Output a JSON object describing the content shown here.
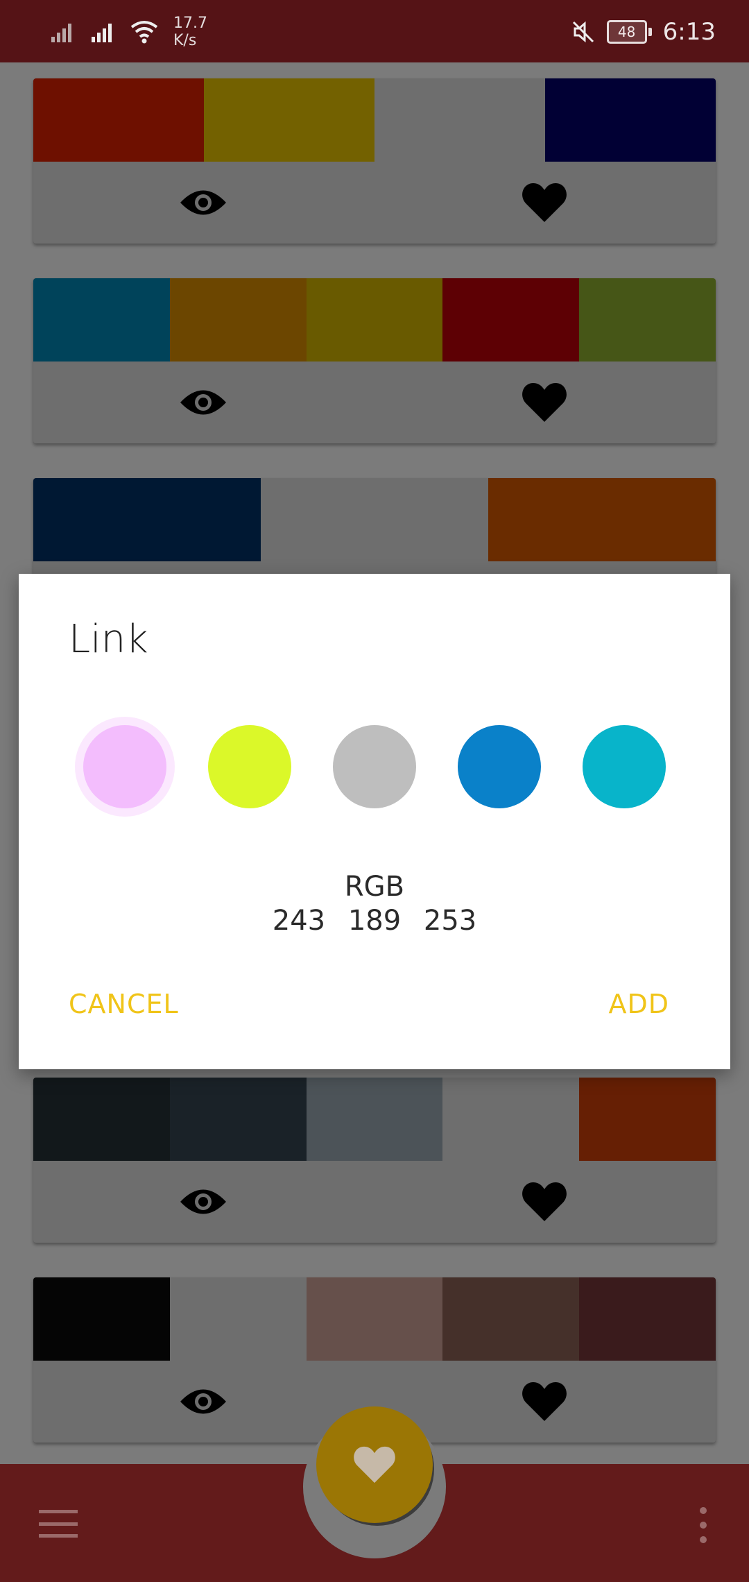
{
  "status_bar": {
    "net_speed_value": "17.7",
    "net_speed_unit": "K/s",
    "battery": "48",
    "time": "6:13"
  },
  "palettes": [
    {
      "colors": [
        "#6e1000",
        "#736100",
        "#6e6e6e",
        "#010034"
      ]
    },
    {
      "colors": [
        "#00435a",
        "#6c4600",
        "#695a00",
        "#5d0004",
        "#465617"
      ]
    },
    {
      "colors": [
        "#001833",
        "#6e6e6e",
        "#6a2c00"
      ]
    },
    {
      "colors": [
        "#12181b",
        "#1a2228",
        "#4c5358",
        "#6e6e6e",
        "#661f04"
      ]
    },
    {
      "colors": [
        "#050505",
        "#6e6e6e",
        "#66504b",
        "#45302a",
        "#3a1b1c"
      ]
    }
  ],
  "dialog": {
    "title": "Link",
    "swatches": [
      "#f3bdfd",
      "#dbf829",
      "#bebebe",
      "#0a81c9",
      "#08b4ca"
    ],
    "selected_index": 0,
    "rgb_label": "RGB",
    "rgb_values": "243   189   253",
    "cancel_label": "CANCEL",
    "add_label": "ADD"
  },
  "colors": {
    "status_bar": "#551316",
    "bottom_bar": "#631b1b",
    "accent": "#f0c419",
    "fab": "#9b7605"
  },
  "icons": {
    "view": "eye-icon",
    "favorite": "heart-icon",
    "menu": "hamburger-menu-icon",
    "more": "more-vert-icon"
  }
}
